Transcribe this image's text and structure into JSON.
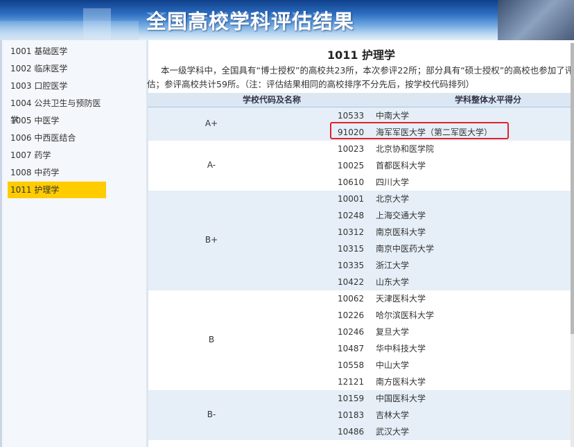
{
  "header": {
    "title": "全国高校学科评估结果"
  },
  "sidebar": {
    "items": [
      {
        "label": "1001 基础医学",
        "active": false
      },
      {
        "label": "1002 临床医学",
        "active": false
      },
      {
        "label": "1003 口腔医学",
        "active": false
      },
      {
        "label": "1004 公共卫生与预防医学",
        "active": false
      },
      {
        "label": "1005 中医学",
        "active": false
      },
      {
        "label": "1006 中西医结合",
        "active": false
      },
      {
        "label": "1007 药学",
        "active": false
      },
      {
        "label": "1008 中药学",
        "active": false
      },
      {
        "label": "1011 护理学",
        "active": true
      }
    ]
  },
  "main": {
    "heading": "1011 护理学",
    "description": "本一级学科中，全国具有“博士授权”的高校共23所，本次参评22所；部分具有“硕士授权”的高校也参加了评估；参评高校共计59所。（注：评估结果相同的高校排序不分先后，按学校代码排列）",
    "table_headers": [
      "学校代码及名称",
      "学科整体水平得分"
    ],
    "groups": [
      {
        "grade": "A+",
        "rows": [
          {
            "code": "10533",
            "name": "中南大学"
          },
          {
            "code": "91020",
            "name": "海军军医大学（第二军医大学）"
          }
        ]
      },
      {
        "grade": "A-",
        "rows": [
          {
            "code": "10023",
            "name": "北京协和医学院"
          },
          {
            "code": "10025",
            "name": "首都医科大学"
          },
          {
            "code": "10610",
            "name": "四川大学"
          }
        ]
      },
      {
        "grade": "B+",
        "rows": [
          {
            "code": "10001",
            "name": "北京大学"
          },
          {
            "code": "10248",
            "name": "上海交通大学"
          },
          {
            "code": "10312",
            "name": "南京医科大学"
          },
          {
            "code": "10315",
            "name": "南京中医药大学"
          },
          {
            "code": "10335",
            "name": "浙江大学"
          },
          {
            "code": "10422",
            "name": "山东大学"
          }
        ]
      },
      {
        "grade": "B",
        "rows": [
          {
            "code": "10062",
            "name": "天津医科大学"
          },
          {
            "code": "10226",
            "name": "哈尔滨医科大学"
          },
          {
            "code": "10246",
            "name": "复旦大学"
          },
          {
            "code": "10487",
            "name": "华中科技大学"
          },
          {
            "code": "10558",
            "name": "中山大学"
          },
          {
            "code": "12121",
            "name": "南方医科大学"
          }
        ]
      },
      {
        "grade": "B-",
        "rows": [
          {
            "code": "10159",
            "name": "中国医科大学"
          },
          {
            "code": "10183",
            "name": "吉林大学"
          },
          {
            "code": "10486",
            "name": "武汉大学"
          }
        ]
      }
    ]
  },
  "colors": {
    "active_nav": "#ffcc00",
    "alt_row": "#e6eff7",
    "highlight_border": "#e0202a",
    "header_row": "#dbe8f4"
  }
}
